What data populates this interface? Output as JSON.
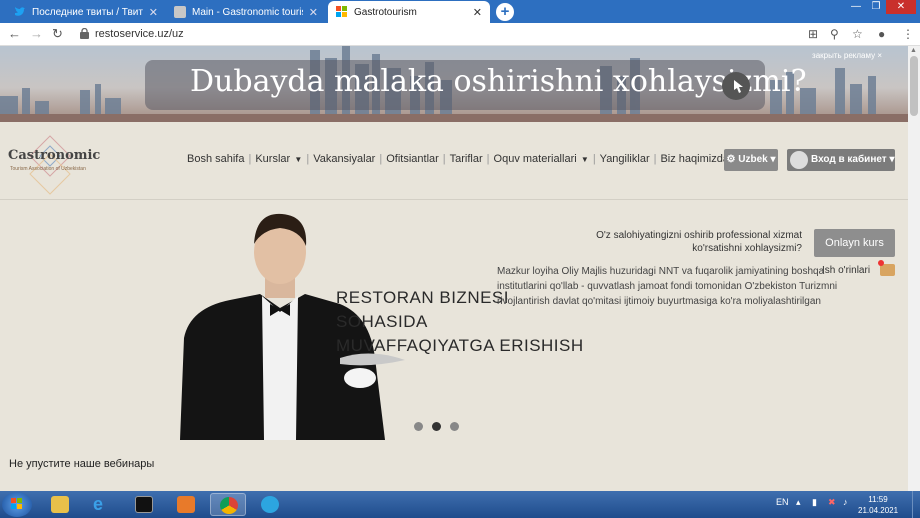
{
  "browser": {
    "tabs": [
      {
        "title": "Последние твиты / Твиттер",
        "icon": "twitter-icon"
      },
      {
        "title": "Main - Gastronomic tourism Association",
        "icon": "site-icon"
      },
      {
        "title": "Gastrotourism",
        "icon": "windows-icon"
      }
    ],
    "new_tab": "+",
    "url": "restoservice.uz/uz"
  },
  "ad": {
    "text": "Dubayda malaka oshirishni xohlaysizmi?",
    "close_label": "закрыть рекламу ×"
  },
  "site": {
    "logo": {
      "name": "Castronomic",
      "tagline": "Tourism Association of Uzbekistan"
    },
    "menu": {
      "home": "Bosh sahifa",
      "courses": "Kurslar",
      "vacancies": "Vakansiyalar",
      "waiters": "Ofitsiantlar",
      "tariffs": "Tariflar",
      "materials": "Oquv materiallari",
      "news": "Yangiliklar",
      "about": "Biz haqimizda"
    },
    "language": "Uzbek",
    "login": "Вход в кабинет"
  },
  "hero": {
    "heading": [
      "RESTORAN BIZNESI",
      "SOHASIDA",
      "MUVAFFAQIYATGA ERISHISH"
    ],
    "paragraph": "Mazkur loyiha Oliy Majlis huzuridagi NNT va fuqarolik jamiyatining boshqa institutlarini qo'llab - quvvatlash jamoat fondi tomonidan O'zbekiston Turizmni rivojlantirish davlat qo'mitasi ijtimoiy buyurtmasiga ko'ra moliyalashtirilgan",
    "cta_text": "O'z salohiyatingizni oshirib professional xizmat ko'rsatishni xohlaysizmi?",
    "cta_button": "Onlayn kurs",
    "jobs": "Ish o'rinlari",
    "slide_count": 3,
    "active_slide": 2
  },
  "webinar_title": "Не упустите наше вебинары",
  "taskbar": {
    "language": "EN",
    "time": "11:59",
    "date": "21.04.2021"
  }
}
